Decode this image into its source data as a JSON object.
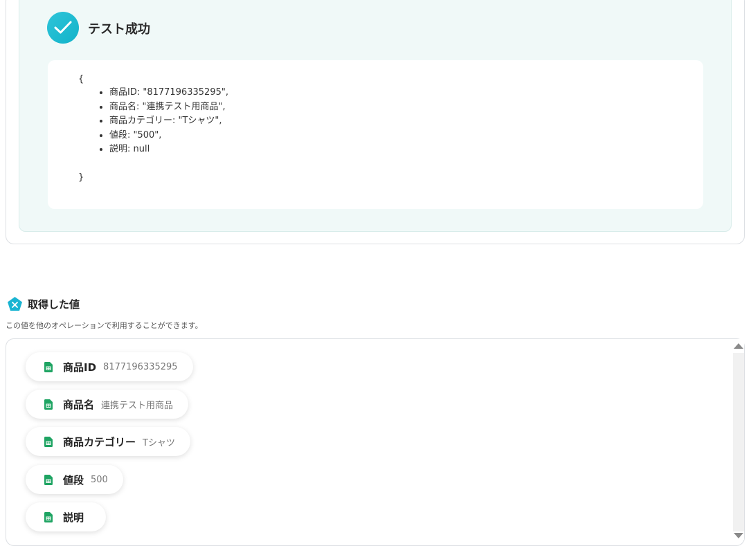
{
  "test_result": {
    "status_title": "テスト成功",
    "open_brace": "{",
    "close_brace": "}",
    "fields": [
      "商品ID: \"8177196335295\",",
      "商品名: \"連携テスト用商品\",",
      "商品カテゴリー: \"Tシャツ\",",
      "値段: \"500\",",
      "説明: null"
    ]
  },
  "obtained_values": {
    "title": "取得した値",
    "description": "この値を他のオペレーションで利用することができます。",
    "items": [
      {
        "key": "商品ID",
        "value": "8177196335295"
      },
      {
        "key": "商品名",
        "value": "連携テスト用商品"
      },
      {
        "key": "商品カテゴリー",
        "value": "Tシャツ"
      },
      {
        "key": "値段",
        "value": "500"
      },
      {
        "key": "説明",
        "value": ""
      }
    ]
  },
  "icons": {
    "success": "check-circle-icon",
    "section": "variable-x-icon",
    "item": "spreadsheet-icon"
  },
  "colors": {
    "accent": "#1fbcd2",
    "panel_bg": "#f0f9f8",
    "sheet_green": "#1fa463"
  }
}
